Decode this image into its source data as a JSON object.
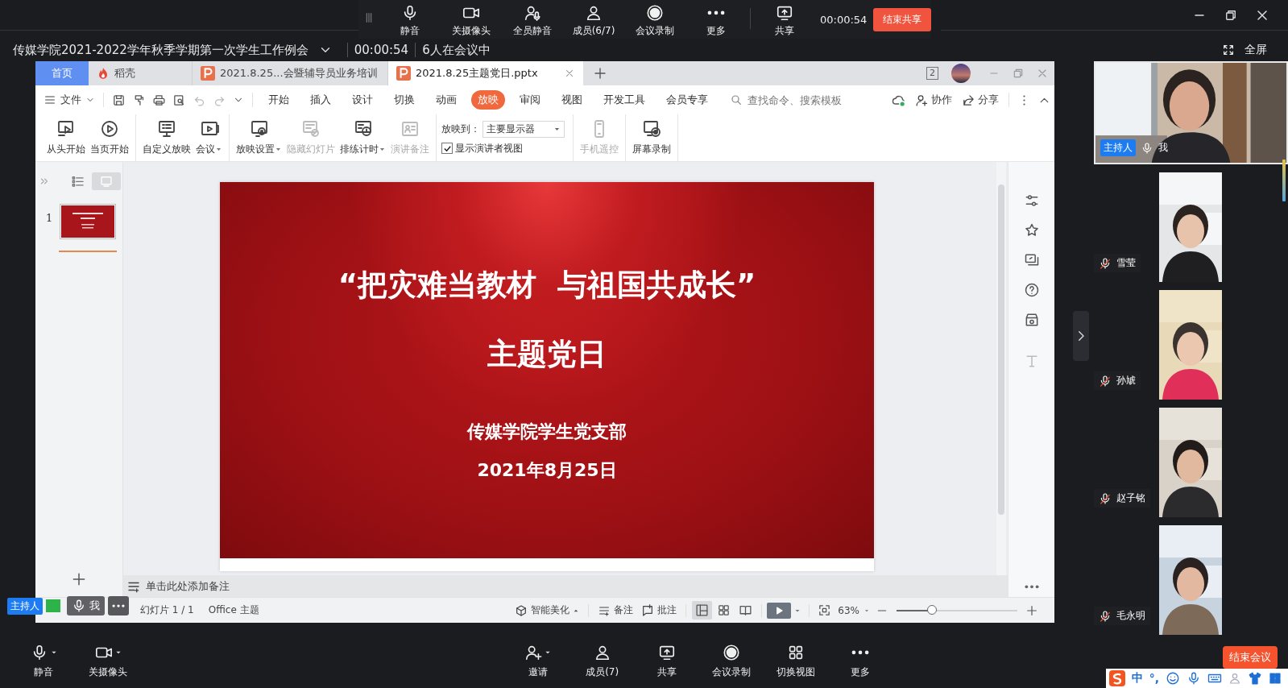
{
  "meeting_toolbar": {
    "items": [
      {
        "label": "静音"
      },
      {
        "label": "关摄像头"
      },
      {
        "label": "全员静音"
      },
      {
        "label": "成员(6/7)"
      },
      {
        "label": "会议录制"
      },
      {
        "label": "更多"
      },
      {
        "label": "共享"
      }
    ],
    "timer": "00:00:54",
    "end_share_button": "结束共享"
  },
  "meeting_info": {
    "title": "传媒学院2021-2022学年秋季学期第一次学生工作例会",
    "elapsed": "00:00:54",
    "participants": "6人在会议中"
  },
  "fullscreen_button": "全屏",
  "wps": {
    "tabs": [
      {
        "label": "首页",
        "kind": "home",
        "selected": false
      },
      {
        "label": "稻壳",
        "kind": "docer",
        "selected": false
      },
      {
        "label": "2021.8.25...会暨辅导员业务培训",
        "kind": "file",
        "selected": false
      },
      {
        "label": "2021.8.25主题党日.pptx",
        "kind": "file",
        "selected": true
      }
    ],
    "window_badge": "2",
    "file_menu": "文件",
    "menu_tabs": [
      {
        "label": "开始",
        "selected": false
      },
      {
        "label": "插入",
        "selected": false
      },
      {
        "label": "设计",
        "selected": false
      },
      {
        "label": "切换",
        "selected": false
      },
      {
        "label": "动画",
        "selected": false
      },
      {
        "label": "放映",
        "selected": true
      },
      {
        "label": "审阅",
        "selected": false
      },
      {
        "label": "视图",
        "selected": false
      },
      {
        "label": "开发工具",
        "selected": false
      },
      {
        "label": "会员专享",
        "selected": false
      }
    ],
    "search": {
      "placeholder": "查找命令、搜索模板"
    },
    "collaborate": "协作",
    "share": "分享",
    "ribbon": [
      {
        "kind": "buttons",
        "buttons": [
          {
            "label": "从头开始",
            "caret": false,
            "disabled": false
          },
          {
            "label": "当页开始",
            "caret": false,
            "disabled": false
          }
        ]
      },
      {
        "kind": "buttons",
        "buttons": [
          {
            "label": "自定义放映",
            "caret": false,
            "disabled": false
          },
          {
            "label": "会议",
            "caret": true,
            "disabled": false
          }
        ]
      },
      {
        "kind": "buttons",
        "buttons": [
          {
            "label": "放映设置",
            "caret": true,
            "disabled": false
          },
          {
            "label": "隐藏幻灯片",
            "caret": false,
            "disabled": true
          },
          {
            "label": "排练计时",
            "caret": true,
            "disabled": false
          },
          {
            "label": "演讲备注",
            "caret": false,
            "disabled": true
          }
        ]
      },
      {
        "kind": "options",
        "play_to_label": "放映到：",
        "play_to_value": "主要显示器",
        "presenter_view": {
          "label": "显示演讲者视图",
          "checked": true
        }
      },
      {
        "kind": "buttons",
        "buttons": [
          {
            "label": "手机遥控",
            "caret": false,
            "disabled": true
          }
        ]
      },
      {
        "kind": "buttons",
        "buttons": [
          {
            "label": "屏幕录制",
            "caret": false,
            "disabled": false
          }
        ]
      }
    ],
    "slides": [
      {
        "number": "1",
        "selected": true
      }
    ],
    "slide": {
      "title": "“把灾难当教材  与祖国共成长”",
      "subtitle": "主题党日",
      "organization": "传媒学院学生党支部",
      "date": "2021年8月25日"
    },
    "notes_placeholder": "单击此处添加备注",
    "status_bar": {
      "slide_counter": "幻灯片 1 / 1",
      "theme": "Office 主题",
      "beautify": "智能美化",
      "notes": "备注",
      "comments": "批注",
      "views": [
        {
          "selected": true
        },
        {
          "selected": false
        },
        {
          "selected": false
        }
      ],
      "zoom": "63%",
      "zoom_slider": {
        "level": 0.3
      }
    }
  },
  "participants": [
    {
      "name": "我",
      "host_label": "主持人",
      "muted": false
    },
    {
      "name": "雪莹",
      "muted": true
    },
    {
      "name": "孙虓",
      "muted": true
    },
    {
      "name": "赵子铭",
      "muted": true
    },
    {
      "name": "毛永明",
      "muted": true
    }
  ],
  "self_overlay": {
    "host_label": "主持人",
    "name": "我"
  },
  "bottom_bar": {
    "left": [
      {
        "label": "静音"
      },
      {
        "label": "关摄像头"
      }
    ],
    "center": [
      {
        "label": "邀请"
      },
      {
        "label": "成员(7)"
      },
      {
        "label": "共享"
      },
      {
        "label": "会议录制"
      },
      {
        "label": "切换视图"
      },
      {
        "label": "更多"
      }
    ],
    "end_meeting_button": "结束会议"
  },
  "ime_bar": {
    "mode": "中",
    "punctuation": "°,"
  }
}
